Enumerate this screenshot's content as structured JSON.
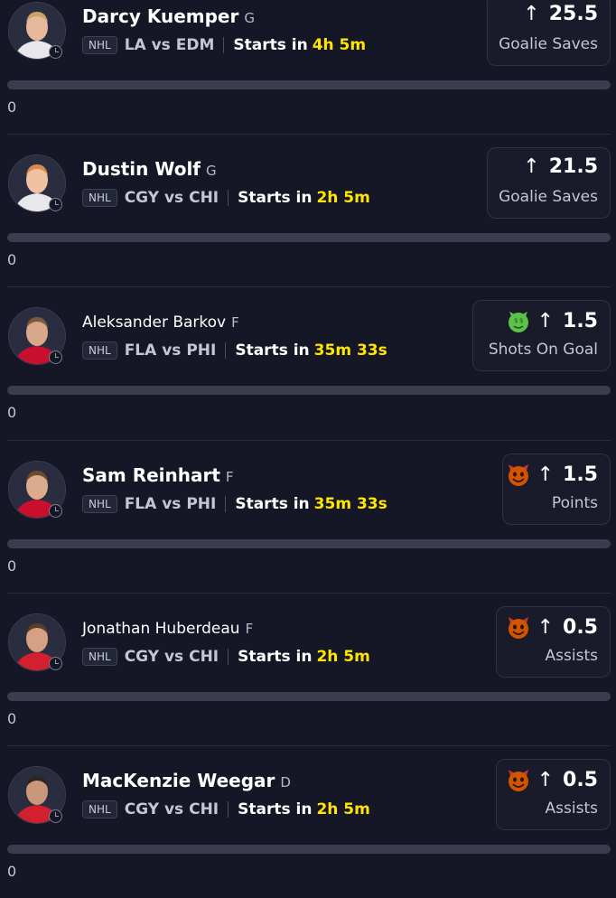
{
  "colors": {
    "background": "#151726",
    "accent_time": "#ffe600",
    "progress_track": "#3a3d4d"
  },
  "players": [
    {
      "name": "Darcy Kuemper",
      "position": "G",
      "league": "NHL",
      "matchup": "LA vs EDM",
      "starts_label": "Starts in",
      "starts_time": "4h 5m",
      "direction_icon": "arrow-up-icon",
      "line": "25.5",
      "stat": "Goalie Saves",
      "emoji_icon": "",
      "progress": 0,
      "count": "0",
      "jersey": "#e8e8ec"
    },
    {
      "name": "Dustin Wolf",
      "position": "G",
      "league": "NHL",
      "matchup": "CGY vs CHI",
      "starts_label": "Starts in",
      "starts_time": "2h 5m",
      "direction_icon": "arrow-up-icon",
      "line": "21.5",
      "stat": "Goalie Saves",
      "emoji_icon": "",
      "progress": 0,
      "count": "0",
      "jersey": "#e8e8ec"
    },
    {
      "name": "Aleksander Barkov",
      "position": "F",
      "league": "NHL",
      "matchup": "FLA vs PHI",
      "starts_label": "Starts in",
      "starts_time": "35m 33s",
      "direction_icon": "arrow-up-icon",
      "line": "1.5",
      "stat": "Shots On Goal",
      "emoji_icon": "money-face-icon",
      "progress": 0,
      "count": "0",
      "jersey": "#c8102e"
    },
    {
      "name": "Sam Reinhart",
      "position": "F",
      "league": "NHL",
      "matchup": "FLA vs PHI",
      "starts_label": "Starts in",
      "starts_time": "35m 33s",
      "direction_icon": "arrow-up-icon",
      "line": "1.5",
      "stat": "Points",
      "emoji_icon": "devil-face-icon",
      "progress": 0,
      "count": "0",
      "jersey": "#c8102e"
    },
    {
      "name": "Jonathan Huberdeau",
      "position": "F",
      "league": "NHL",
      "matchup": "CGY vs CHI",
      "starts_label": "Starts in",
      "starts_time": "2h 5m",
      "direction_icon": "arrow-up-icon",
      "line": "0.5",
      "stat": "Assists",
      "emoji_icon": "devil-face-icon",
      "progress": 0,
      "count": "0",
      "jersey": "#d2202f"
    },
    {
      "name": "MacKenzie Weegar",
      "position": "D",
      "league": "NHL",
      "matchup": "CGY vs CHI",
      "starts_label": "Starts in",
      "starts_time": "2h 5m",
      "direction_icon": "arrow-up-icon",
      "line": "0.5",
      "stat": "Assists",
      "emoji_icon": "devil-face-icon",
      "progress": 0,
      "count": "0",
      "jersey": "#d2202f"
    }
  ]
}
